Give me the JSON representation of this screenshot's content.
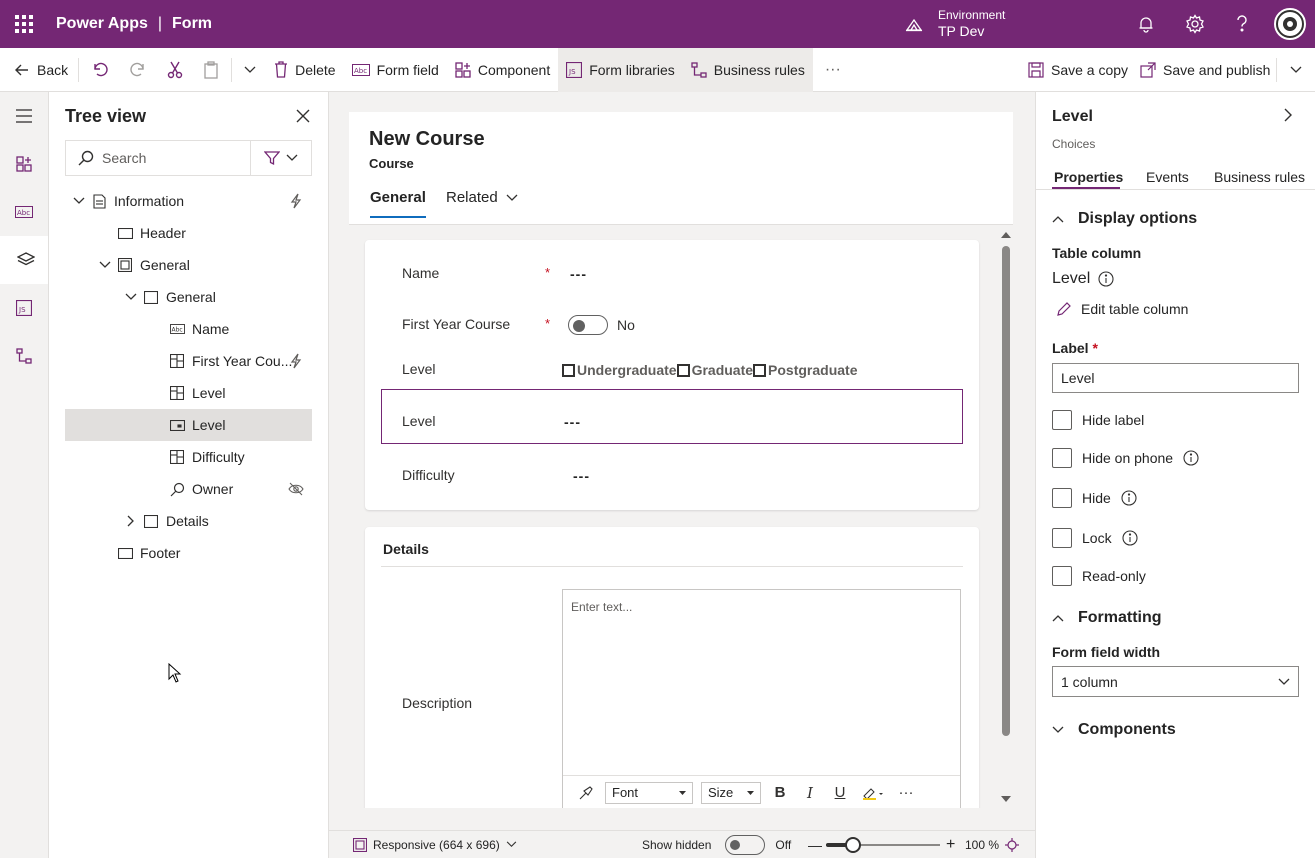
{
  "topbar": {
    "app_name": "Power Apps",
    "separator": "|",
    "page_name": "Form",
    "environment_label": "Environment",
    "environment_name": "TP Dev"
  },
  "commandbar": {
    "back": "Back",
    "delete": "Delete",
    "form_field": "Form field",
    "component": "Component",
    "form_libraries": "Form libraries",
    "business_rules": "Business rules",
    "more": "···",
    "save_copy": "Save a copy",
    "save_publish": "Save and publish"
  },
  "tree": {
    "title": "Tree view",
    "search_placeholder": "Search",
    "items": [
      {
        "label": "Information",
        "icon": "form-icon",
        "expanded": true
      },
      {
        "label": "Header",
        "icon": "header-icon"
      },
      {
        "label": "General",
        "icon": "tab-icon",
        "expanded": true
      },
      {
        "label": "General",
        "icon": "section-icon",
        "expanded": true
      },
      {
        "label": "Name",
        "icon": "text-field-icon"
      },
      {
        "label": "First Year Cou...",
        "icon": "choice-icon",
        "badge": "lightning-icon"
      },
      {
        "label": "Level",
        "icon": "choice-icon"
      },
      {
        "label": "Level",
        "icon": "dropdown-field-icon",
        "selected": true
      },
      {
        "label": "Difficulty",
        "icon": "choice-icon"
      },
      {
        "label": "Owner",
        "icon": "lookup-icon",
        "badge": "hidden-eye-icon"
      },
      {
        "label": "Details",
        "icon": "section-icon",
        "expanded": false
      },
      {
        "label": "Footer",
        "icon": "footer-icon"
      }
    ]
  },
  "form": {
    "title": "New Course",
    "entity": "Course",
    "tab_general": "General",
    "tab_related": "Related",
    "fields": {
      "name_label": "Name",
      "name_value": "---",
      "required_mark": "*",
      "fyc_label": "First Year Course",
      "fyc_value": "No",
      "level_label": "Level",
      "level_options": [
        "Undergraduate",
        "Graduate",
        "Postgraduate"
      ],
      "level2_label": "Level",
      "level2_value": "---",
      "difficulty_label": "Difficulty",
      "difficulty_value": "---"
    },
    "details": {
      "title": "Details",
      "description_label": "Description",
      "placeholder": "Enter text...",
      "font": "Font",
      "size": "Size",
      "bold": "B",
      "italic": "I",
      "underline": "U",
      "more": "···"
    }
  },
  "statusbar": {
    "responsive": "Responsive (664 x 696)",
    "show_hidden": "Show hidden",
    "show_hidden_state": "Off",
    "zoom_minus": "—",
    "zoom_plus": "+",
    "zoom_value": "100 %",
    "zoom_level": 0.25
  },
  "properties": {
    "title": "Level",
    "subtitle": "Choices",
    "tabs": [
      "Properties",
      "Events",
      "Business rules"
    ],
    "display_options": "Display options",
    "table_column_label": "Table column",
    "table_column_value": "Level",
    "edit_table_column": "Edit table column",
    "label_label": "Label",
    "label_required": "*",
    "label_value": "Level",
    "checks": [
      "Hide label",
      "Hide on phone",
      "Hide",
      "Lock",
      "Read-only"
    ],
    "formatting": "Formatting",
    "form_field_width_label": "Form field width",
    "form_field_width_value": "1 column",
    "components": "Components"
  },
  "colors": {
    "brand": "#742774",
    "accent_tab": "#0f6cbd",
    "required": "#c50f1f"
  }
}
